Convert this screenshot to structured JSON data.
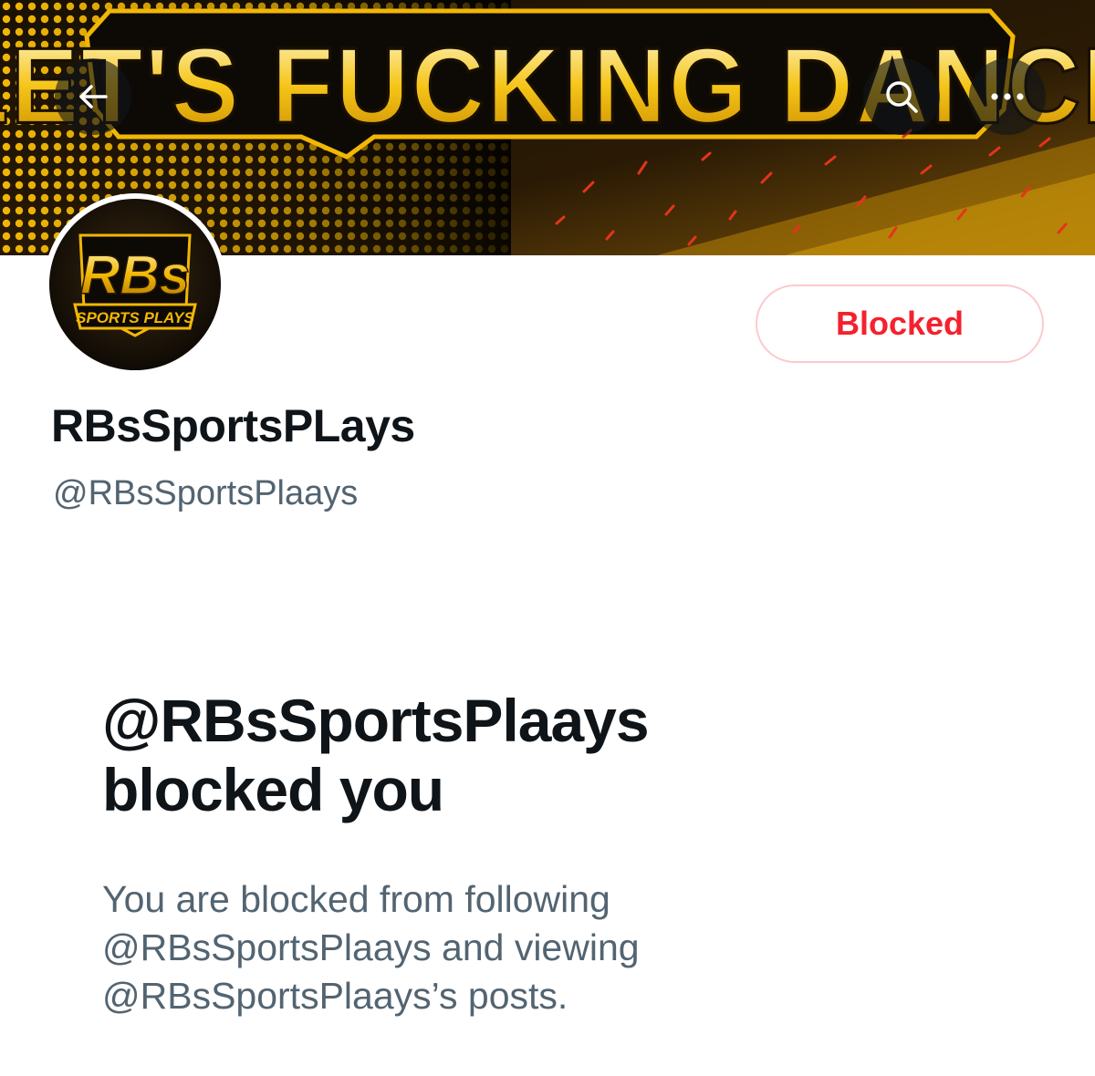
{
  "banner": {
    "headline": "LET'S FUCKING DANCE"
  },
  "nav": {
    "back_icon": "arrow-left-icon",
    "search_icon": "search-icon",
    "more_icon": "more-horizontal-icon"
  },
  "avatar": {
    "logo_text_main": "RBs",
    "logo_text_sub": "SPORTS PLAYS"
  },
  "profile": {
    "display_name": "RBsSportsPLays",
    "handle": "@RBsSportsPlaays",
    "action_label": "Blocked"
  },
  "notice": {
    "title_line1": "@RBsSportsPlaays",
    "title_line2": "blocked you",
    "desc_line1": "You are blocked from following",
    "desc_line2": "@RBsSportsPlaays and viewing",
    "desc_line3": "@RBsSportsPlaays’s posts."
  },
  "colors": {
    "blocked_red": "#f4212e",
    "blocked_border": "#fdc9ce",
    "text_primary": "#0f1419",
    "text_secondary": "#536471",
    "banner_gold": "#f2b705"
  }
}
